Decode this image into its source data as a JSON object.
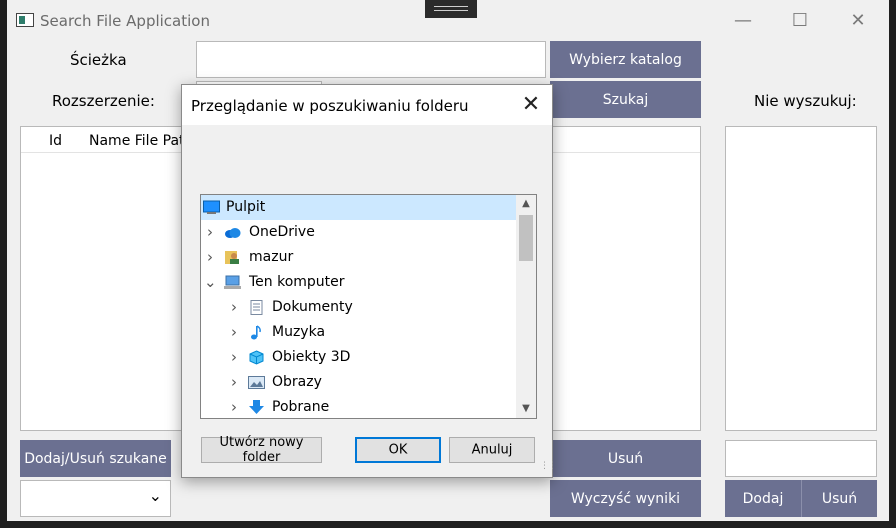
{
  "window": {
    "title": "Search File Application",
    "minimize": "—",
    "maximize": "☐",
    "close": "✕"
  },
  "form": {
    "path_label": "Ścieżka",
    "path_value": "",
    "choose_dir_button": "Wybierz katalog",
    "extension_label": "Rozszerzenie:",
    "search_button": "Szukaj",
    "exclude_label": "Nie wyszukuj:",
    "add_remove_button": "Dodaj/Usuń szukane",
    "remove_button": "Usuń",
    "clear_results_button": "Wyczyść wyniki",
    "add_button": "Dodaj",
    "remove_exclude_button": "Usuń",
    "dropdown_arrow": "⌄"
  },
  "results_table": {
    "columns": [
      "Id",
      "Name File Pat"
    ]
  },
  "dialog": {
    "title": "Przeglądanie w poszukiwaniu folderu",
    "close": "✕",
    "tree": [
      {
        "label": "Pulpit",
        "icon": "desktop-icon",
        "selected": true
      },
      {
        "label": "OneDrive",
        "icon": "cloud-icon",
        "chevron": "›"
      },
      {
        "label": "mazur",
        "icon": "user-folder-icon",
        "chevron": "›"
      },
      {
        "label": "Ten komputer",
        "icon": "computer-icon",
        "chevron": "⌄"
      },
      {
        "label": "Dokumenty",
        "icon": "document-icon",
        "chevron": "›"
      },
      {
        "label": "Muzyka",
        "icon": "music-icon",
        "chevron": "›"
      },
      {
        "label": "Obiekty 3D",
        "icon": "cube-icon",
        "chevron": "›"
      },
      {
        "label": "Obrazy",
        "icon": "picture-icon",
        "chevron": "›"
      },
      {
        "label": "Pobrane",
        "icon": "download-icon",
        "chevron": "›"
      }
    ],
    "scroll_up": "▲",
    "scroll_down": "▼",
    "new_folder_button": "Utwórz nowy folder",
    "ok_button": "OK",
    "cancel_button": "Anuluj"
  },
  "colors": {
    "button_bg": "#6b7091",
    "selection": "#cce8ff",
    "window_bg": "#f0f0f0"
  }
}
